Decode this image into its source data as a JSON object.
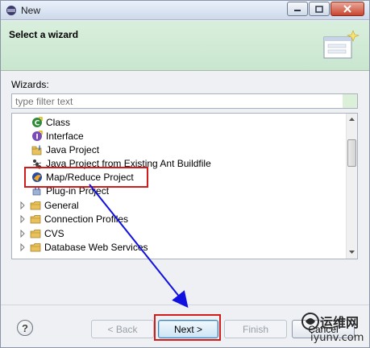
{
  "window": {
    "title": "New",
    "controls": [
      "minimize",
      "maximize",
      "close"
    ]
  },
  "banner": {
    "heading": "Select a wizard"
  },
  "wizards_label": "Wizards:",
  "filter": {
    "placeholder": "type filter text",
    "value": ""
  },
  "tree": {
    "items": [
      {
        "label": "Class",
        "icon": "class-icon",
        "type": "leaf"
      },
      {
        "label": "Interface",
        "icon": "interface-icon",
        "type": "leaf"
      },
      {
        "label": "Java Project",
        "icon": "java-project-icon",
        "type": "leaf"
      },
      {
        "label": "Java Project from Existing Ant Buildfile",
        "icon": "ant-icon",
        "type": "leaf"
      },
      {
        "label": "Map/Reduce Project",
        "icon": "mapreduce-icon",
        "type": "leaf",
        "highlighted": true
      },
      {
        "label": "Plug-in Project",
        "icon": "plugin-icon",
        "type": "leaf"
      },
      {
        "label": "General",
        "icon": "folder-icon",
        "type": "folder"
      },
      {
        "label": "Connection Profiles",
        "icon": "folder-icon",
        "type": "folder"
      },
      {
        "label": "CVS",
        "icon": "folder-icon",
        "type": "folder"
      },
      {
        "label": "Database Web Services",
        "icon": "folder-icon",
        "type": "folder"
      }
    ]
  },
  "buttons": {
    "help": "?",
    "back": "< Back",
    "next": "Next >",
    "finish": "Finish",
    "cancel": "Cancel"
  },
  "watermark": {
    "text_cn": "运维网",
    "text_en": "iyunv.com"
  },
  "colors": {
    "annotation_red": "#d21c1c",
    "annotation_arrow_blue": "#1010e0",
    "banner_green": "#d9efdd"
  }
}
